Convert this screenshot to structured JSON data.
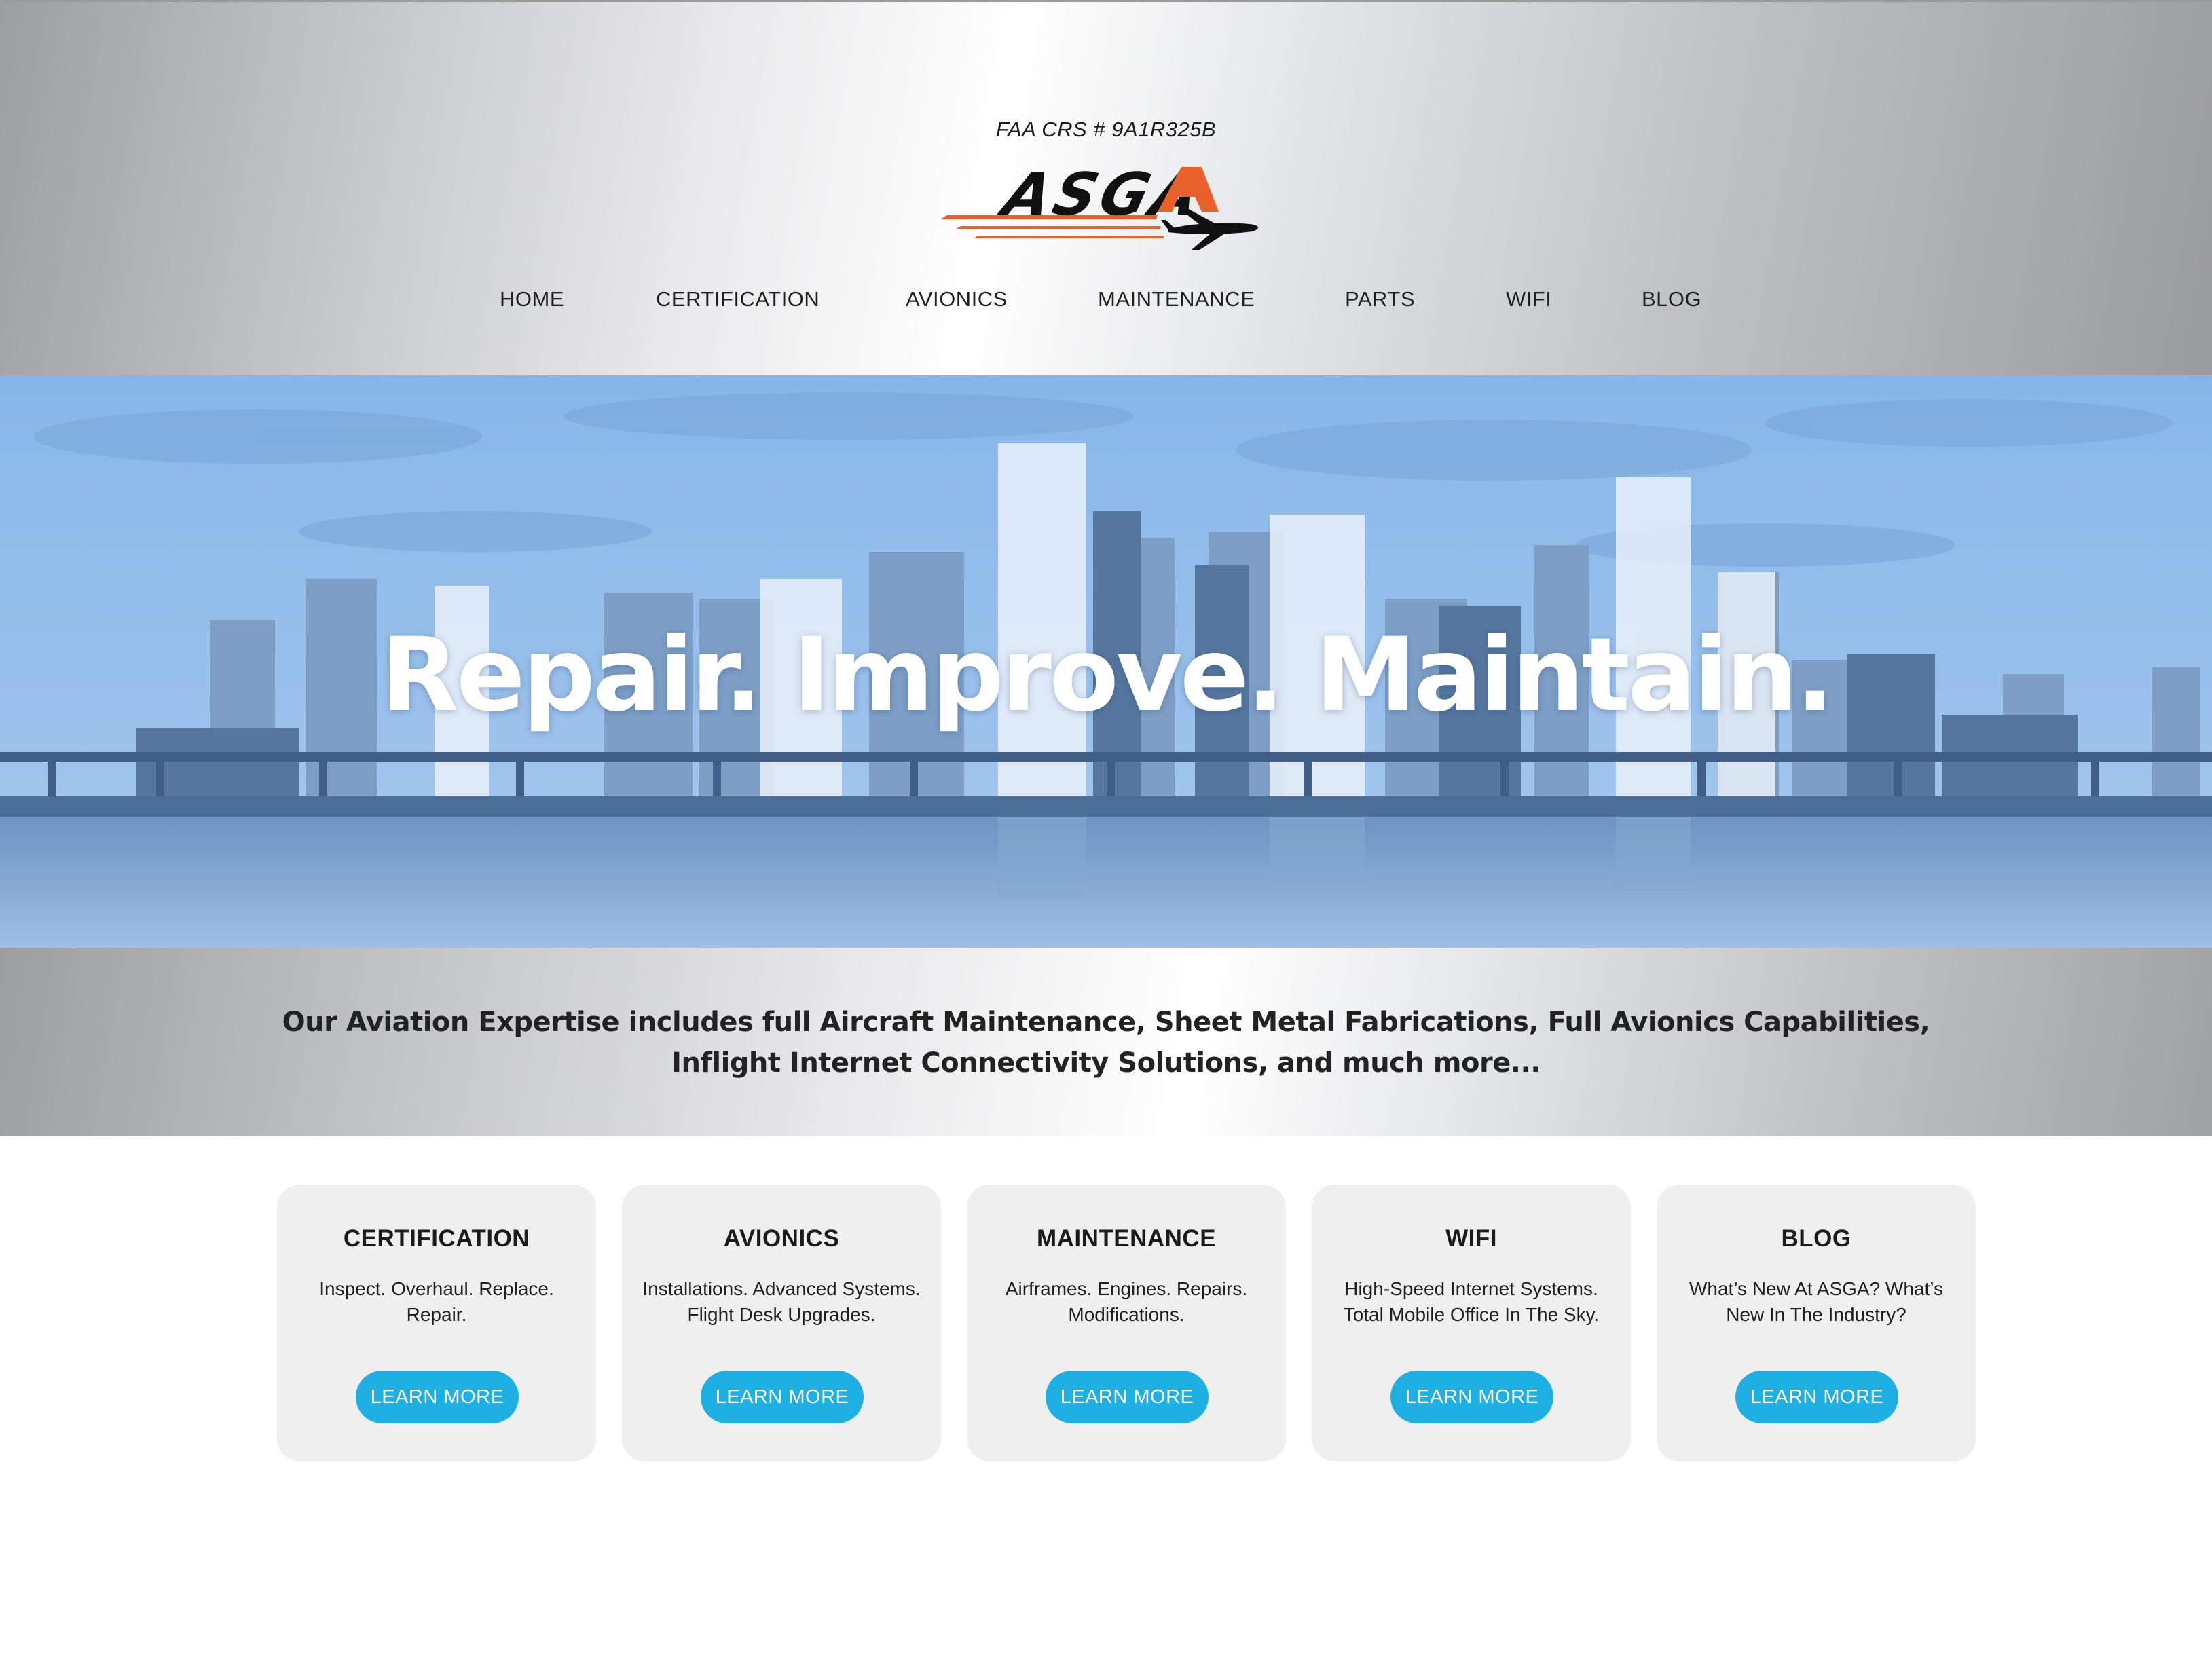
{
  "header": {
    "certificate_text": "FAA CRS # 9A1R325B",
    "logo_text": "ASGA",
    "nav": [
      {
        "label": "HOME"
      },
      {
        "label": "CERTIFICATION"
      },
      {
        "label": "AVIONICS"
      },
      {
        "label": "MAINTENANCE"
      },
      {
        "label": "PARTS"
      },
      {
        "label": "WIFI"
      },
      {
        "label": "BLOG"
      }
    ]
  },
  "hero": {
    "title": "Repair. Improve. Maintain.",
    "image": "city-skyline-blue-tint"
  },
  "expertise": {
    "text": "Our Aviation Expertise includes full Aircraft Maintenance, Sheet Metal Fabrications, Full Avionics Capabilities, Inflight Internet Connectivity Solutions, and much more..."
  },
  "cards": [
    {
      "title": "CERTIFICATION",
      "description": "Inspect. Overhaul. Replace. Repair.",
      "button": "LEARN MORE"
    },
    {
      "title": "AVIONICS",
      "description": "Installations. Advanced Systems. Flight Desk Upgrades.",
      "button": "LEARN MORE"
    },
    {
      "title": "MAINTENANCE",
      "description": "Airframes. Engines. Repairs. Modifications.",
      "button": "LEARN MORE"
    },
    {
      "title": "WIFI",
      "description": "High-Speed Internet Systems. Total Mobile Office In The Sky.",
      "button": "LEARN MORE"
    },
    {
      "title": "BLOG",
      "description": "What’s New At ASGA? What’s New In The Industry?",
      "button": "LEARN MORE"
    }
  ],
  "colors": {
    "accent_button": "#1fb0e3",
    "logo_orange": "#e8612a",
    "hero_tint": "#8ab8e8"
  }
}
